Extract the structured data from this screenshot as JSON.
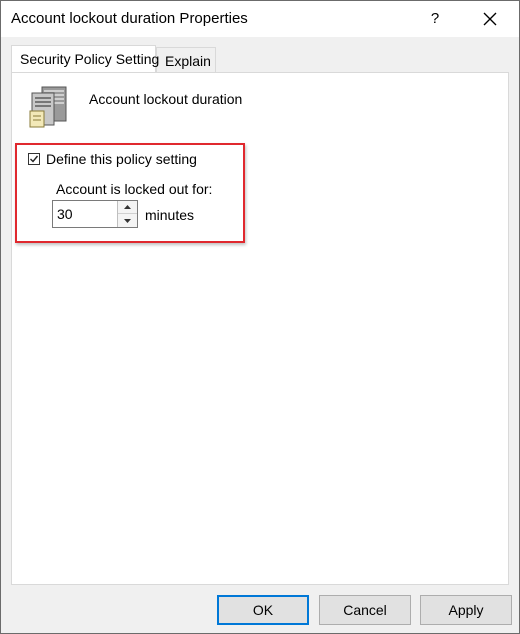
{
  "window": {
    "title": "Account lockout duration Properties",
    "help_label": "?"
  },
  "tabs": [
    {
      "label": "Security Policy Setting",
      "active": true
    },
    {
      "label": "Explain",
      "active": false
    }
  ],
  "policy": {
    "icon": "server-icon",
    "name": "Account lockout duration",
    "define_checked": true,
    "define_label": "Define this policy setting",
    "lockout_label": "Account is locked out for:",
    "duration_value": "30",
    "duration_unit": "minutes"
  },
  "buttons": {
    "ok": "OK",
    "cancel": "Cancel",
    "apply": "Apply"
  },
  "colors": {
    "highlight": "#e0282e",
    "default_button_border": "#0078d7"
  }
}
